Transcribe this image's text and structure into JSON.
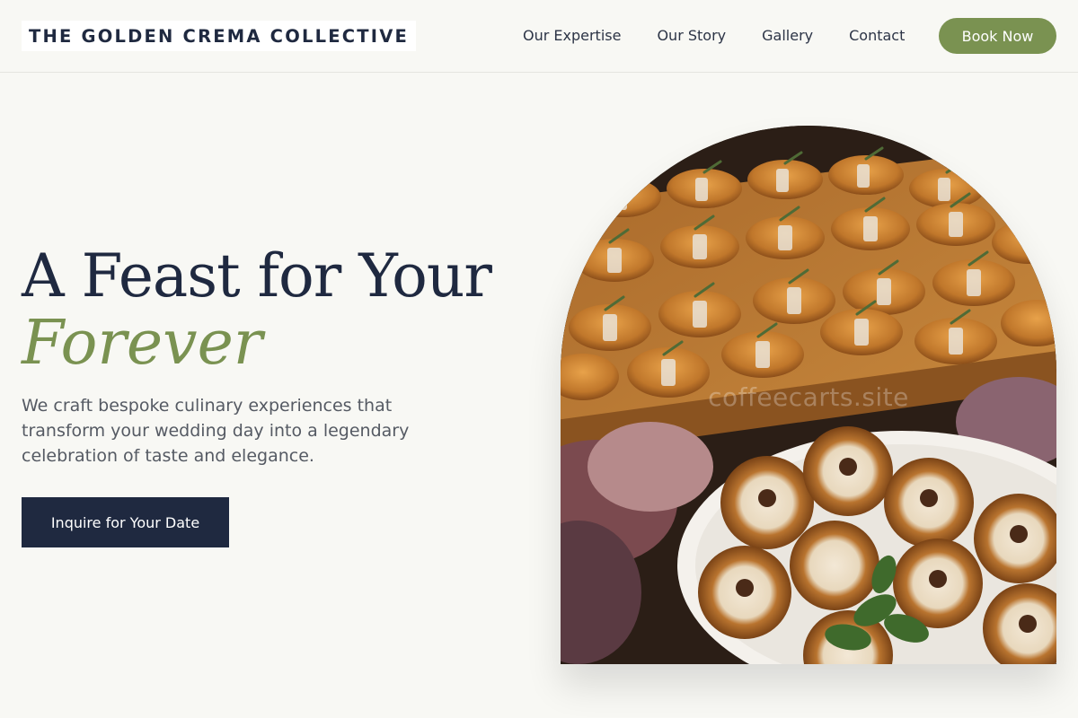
{
  "brand": {
    "name": "THE GOLDEN CREMA COLLECTIVE"
  },
  "nav": {
    "items": [
      {
        "label": "Our Expertise"
      },
      {
        "label": "Our Story"
      },
      {
        "label": "Gallery"
      },
      {
        "label": "Contact"
      }
    ],
    "book_label": "Book Now"
  },
  "hero": {
    "title_line1": "A Feast for Your",
    "title_line2": "Forever",
    "subtitle": "We craft bespoke culinary experiences that transform your wedding day into a legendary celebration of taste and elegance.",
    "cta_label": "Inquire for Your Date",
    "image_watermark": "coffeecarts.site"
  },
  "colors": {
    "accent": "#7a9251",
    "primary": "#1f2940",
    "background": "#f8f8f4"
  }
}
